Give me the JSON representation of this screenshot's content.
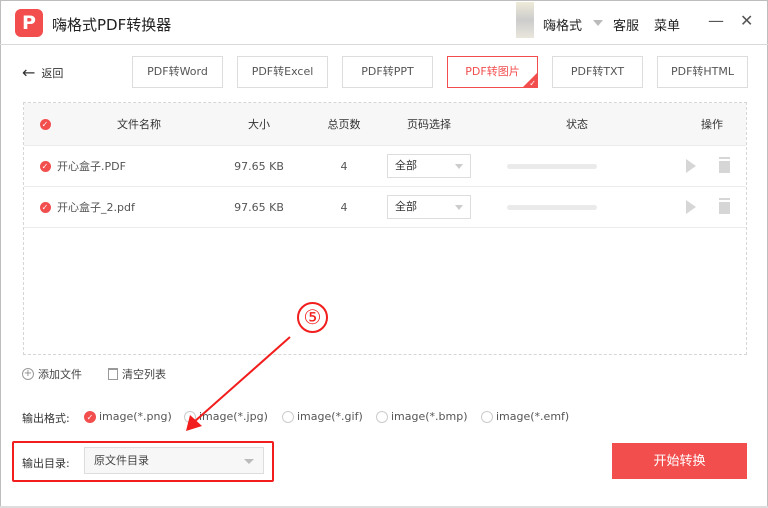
{
  "app": {
    "logo": "P",
    "title": "嗨格式PDF转换器",
    "user": "嗨格式",
    "service": "客服",
    "menu": "菜单",
    "minimize": "—",
    "close": "✕"
  },
  "nav": {
    "back": "返回",
    "tabs": [
      "PDF转Word",
      "PDF转Excel",
      "PDF转PPT",
      "PDF转图片",
      "PDF转TXT",
      "PDF转HTML"
    ],
    "active_tab": 3
  },
  "table": {
    "headers": {
      "name": "文件名称",
      "size": "大小",
      "pages": "总页数",
      "range": "页码选择",
      "status": "状态",
      "ops": "操作"
    },
    "rows": [
      {
        "name": "开心盒子.PDF",
        "size": "97.65 KB",
        "pages": "4",
        "range": "全部",
        "progress": 0
      },
      {
        "name": "开心盒子_2.pdf",
        "size": "97.65 KB",
        "pages": "4",
        "range": "全部",
        "progress": 0
      }
    ]
  },
  "actions": {
    "add": "添加文件",
    "clear": "清空列表"
  },
  "format": {
    "label": "输出格式:",
    "options": [
      "image(*.png)",
      "image(*.jpg)",
      "image(*.gif)",
      "image(*.bmp)",
      "image(*.emf)"
    ],
    "selected": 0
  },
  "output": {
    "label": "输出目录:",
    "value": "原文件目录"
  },
  "start": "开始转换",
  "annotation": {
    "step": "⑤",
    "color": "#f21d1d"
  },
  "colors": {
    "accent": "#f24e4e"
  }
}
